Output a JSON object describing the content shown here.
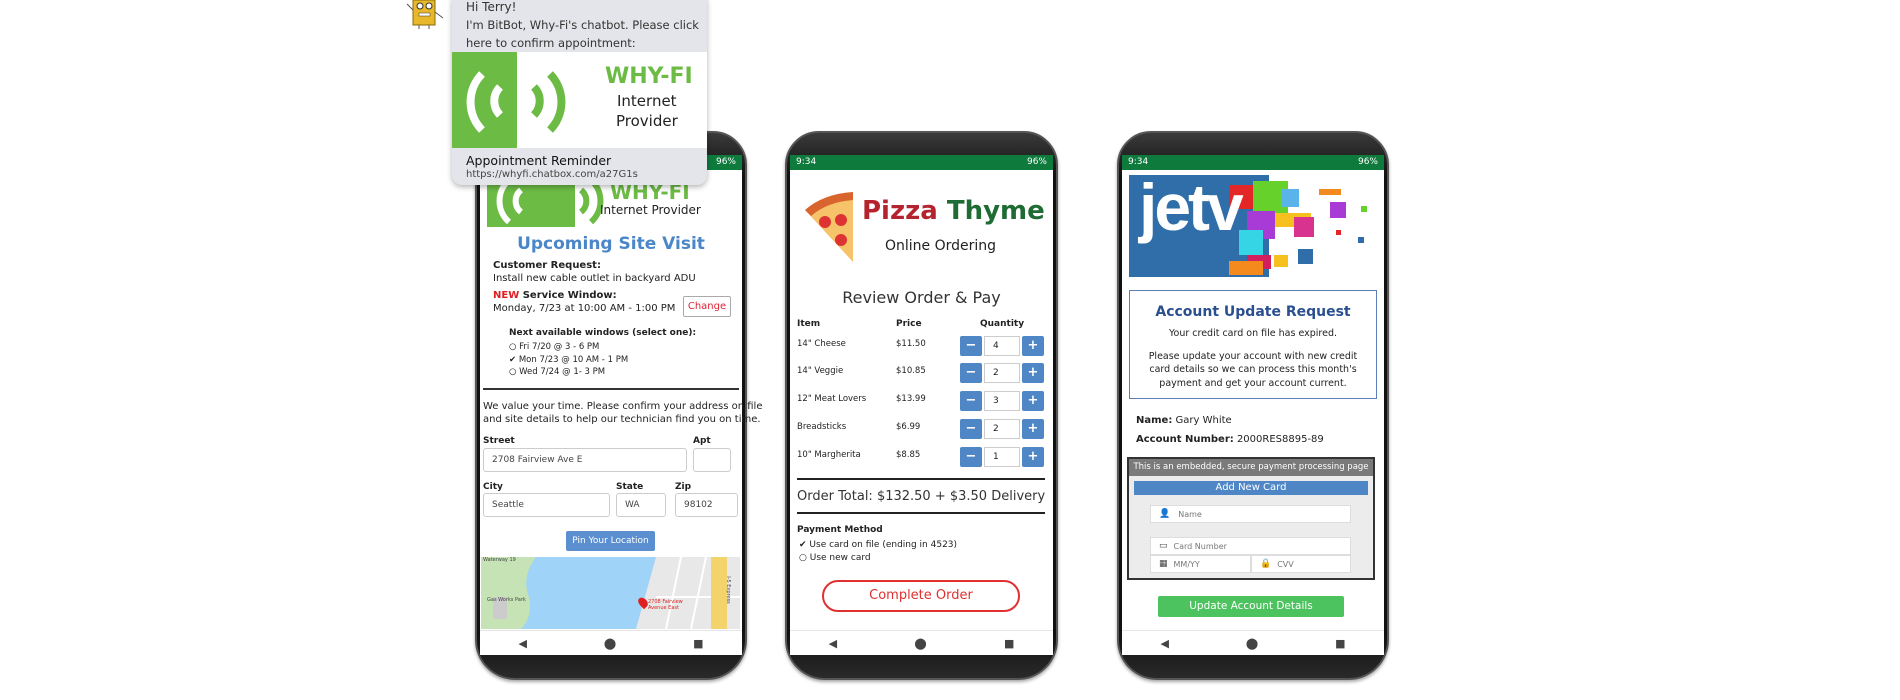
{
  "chatbot": {
    "greeting": "Hi Terry!",
    "message_line1": "I'm BitBot, Why-Fi's chatbot. Please click",
    "message_line2": "here to confirm appointment:",
    "brand_name": "WHY-FI",
    "brand_line1": "Internet",
    "brand_line2": "Provider",
    "link_title": "Appointment Reminder",
    "link_url": "https://whyfi.chatbox.com/a27G1s"
  },
  "status_bar": {
    "time": "9:34",
    "battery": "96%"
  },
  "whyfi": {
    "brand_name": "WHY-FI",
    "brand_sub": "Internet Provider",
    "title": "Upcoming Site Visit",
    "request_label": "Customer Request:",
    "request_text": "Install new cable outlet in backyard ADU",
    "new_badge": "NEW",
    "window_label": "Service Window:",
    "window_text": "Monday, 7/23 at 10:00 AM - 1:00 PM",
    "change_label": "Change",
    "next_label": "Next available windows (select one):",
    "windows": [
      {
        "label": "Fri 7/20 @ 3 - 6 PM",
        "selected": false
      },
      {
        "label": "Mon 7/23 @ 10 AM - 1 PM",
        "selected": true
      },
      {
        "label": "Wed 7/24 @ 1- 3 PM",
        "selected": false
      }
    ],
    "intro_line1": "We value your time. Please confirm your address on file",
    "intro_line2": "and site details to help our technician find you on time.",
    "street_label": "Street",
    "street_value": "2708 Fairview Ave E",
    "apt_label": "Apt",
    "apt_value": "",
    "city_label": "City",
    "city_value": "Seattle",
    "state_label": "State",
    "state_value": "WA",
    "zip_label": "Zip",
    "zip_value": "98102",
    "pin_label": "Pin Your Location",
    "map": {
      "park": "Gas Works Park",
      "waterway": "Waterway 19",
      "pin_line1": "2708 Fairview",
      "pin_line2": "Avenue East",
      "highway": "I-5 Express"
    }
  },
  "pizza": {
    "brand_word1": "Pizza",
    "brand_word2": "Thyme",
    "subtitle": "Online Ordering",
    "title": "Review Order & Pay",
    "headers": [
      "Item",
      "Price",
      "Quantity"
    ],
    "items": [
      {
        "name": "14\" Cheese",
        "price": "$11.50",
        "qty": "4"
      },
      {
        "name": "14\" Veggie",
        "price": "$10.85",
        "qty": "2"
      },
      {
        "name": "12\" Meat Lovers",
        "price": "$13.99",
        "qty": "3"
      },
      {
        "name": "Breadsticks",
        "price": "$6.99",
        "qty": "2"
      },
      {
        "name": "10\" Margherita",
        "price": "$8.85",
        "qty": "1"
      }
    ],
    "total": "Order Total: $132.50 + $3.50 Delivery",
    "payment_label": "Payment Method",
    "payment_options": [
      {
        "label": "Use card on file (ending in 4523)",
        "selected": true
      },
      {
        "label": "Use new card",
        "selected": false
      }
    ],
    "complete_label": "Complete Order"
  },
  "jetv": {
    "logo_text": "jetv",
    "box_title": "Account Update Request",
    "box_line1": "Your credit card on file has expired.",
    "box_line2": "Please update your account with new credit",
    "box_line3": "card details so we can process this month's",
    "box_line4": "payment and get your account current.",
    "name_label": "Name:",
    "name_value": "Gary White",
    "account_label": "Account Number:",
    "account_value": "2000RES8895-89",
    "embed_notice": "This is an embedded, secure payment processing page",
    "add_card_label": "Add New Card",
    "name_placeholder": "Name",
    "card_placeholder": "Card Number",
    "expiry_placeholder": "MM/YY",
    "cvv_placeholder": "CVV",
    "update_label": "Update Account Details"
  },
  "colors": {
    "status_green": "#0e7a3c",
    "whyfi_green": "#6cbb45",
    "link_blue": "#4f86c6",
    "pizza_red": "#b5232f",
    "pizza_green": "#1f6b34",
    "alert_red": "#e03030",
    "jetv_blue": "#2f6ea8",
    "update_green": "#4cc35e"
  }
}
